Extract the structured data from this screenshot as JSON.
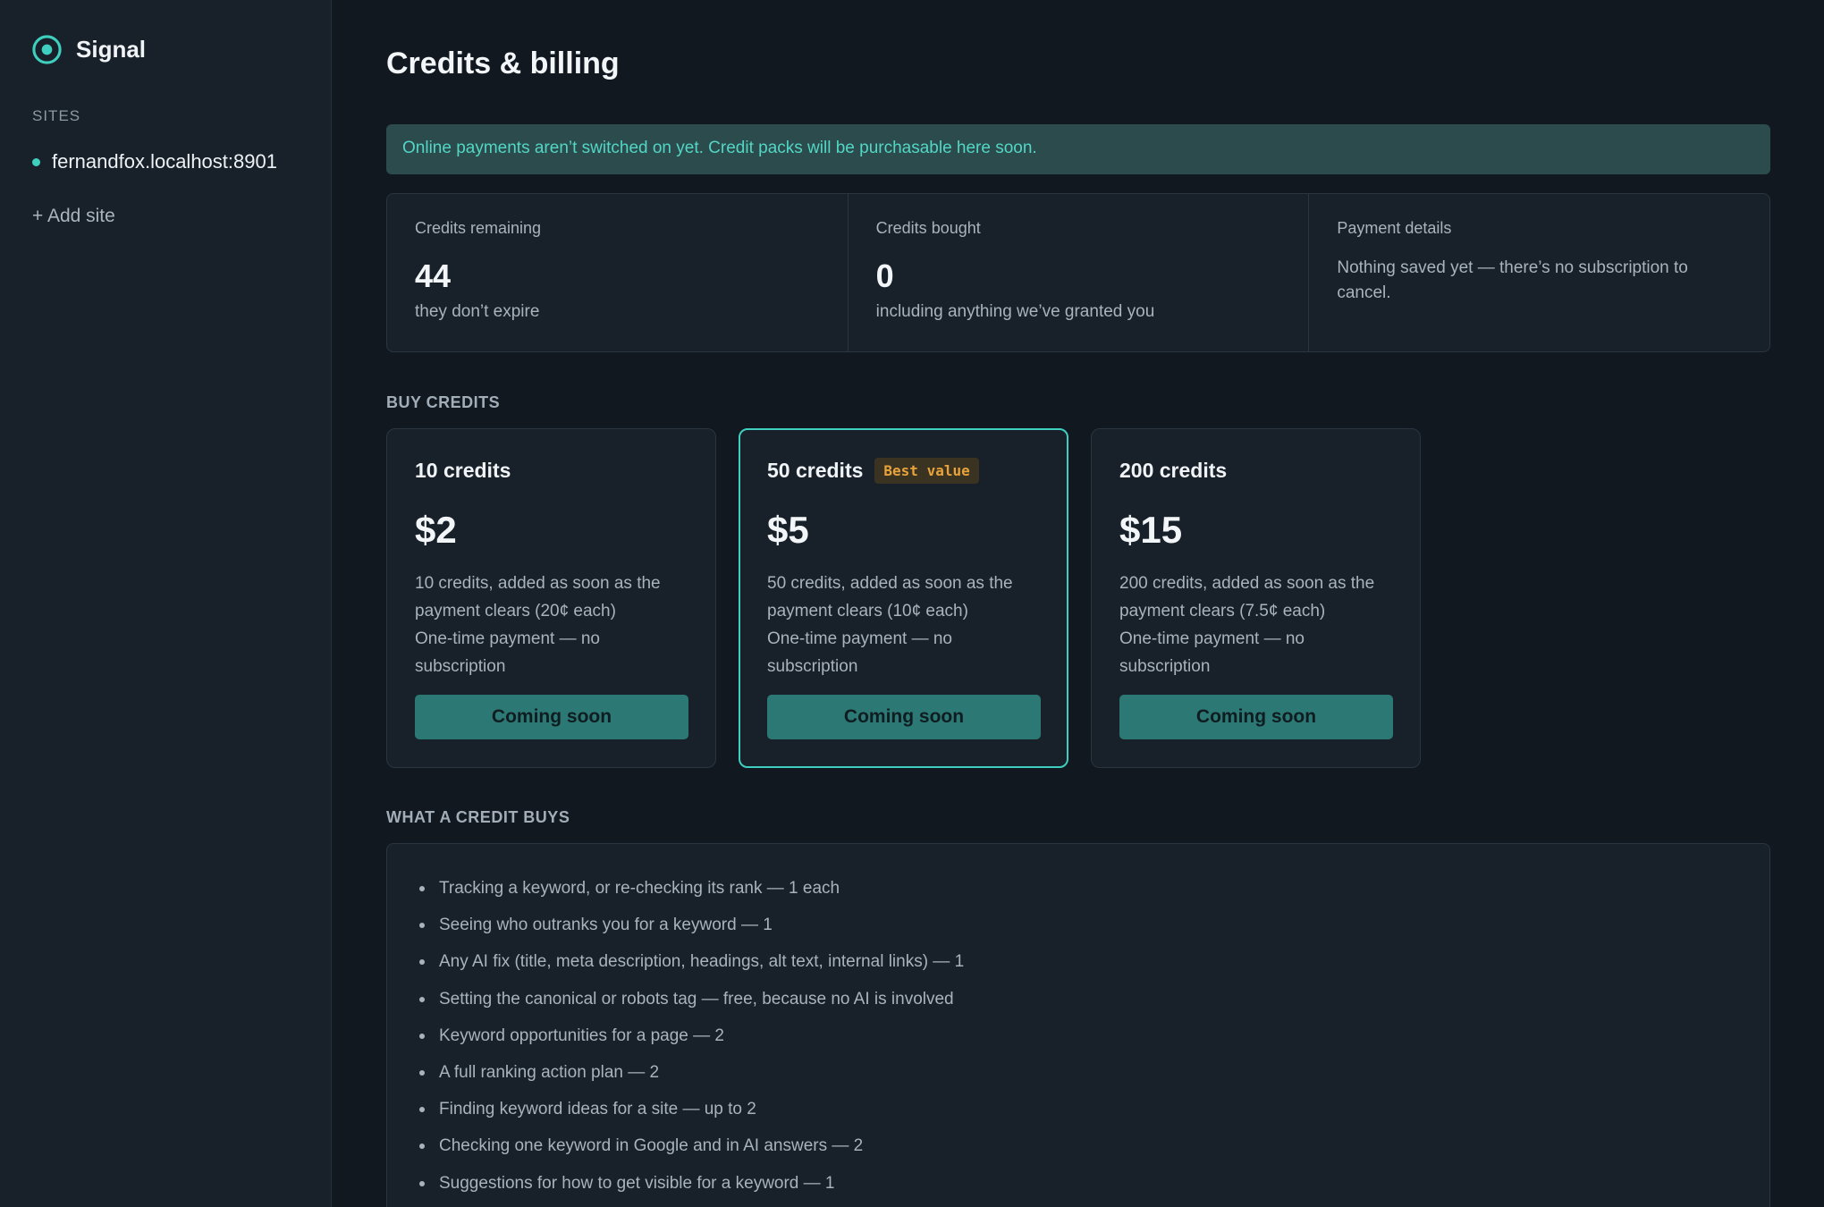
{
  "app": {
    "name": "Signal"
  },
  "sidebar": {
    "heading": "SITES",
    "sites": [
      {
        "label": "fernandfox.localhost:8901"
      }
    ],
    "add_site": "+ Add site"
  },
  "page": {
    "title": "Credits & billing",
    "notice": "Online payments aren’t switched on yet. Credit packs will be purchasable here soon."
  },
  "stats": {
    "remaining": {
      "label": "Credits remaining",
      "value": "44",
      "sub": "they don’t expire"
    },
    "bought": {
      "label": "Credits bought",
      "value": "0",
      "sub": "including anything we’ve granted you"
    },
    "payment": {
      "label": "Payment details",
      "desc": "Nothing saved yet — there’s no subscription to cancel."
    }
  },
  "buy": {
    "heading": "BUY CREDITS",
    "packs": [
      {
        "name": "10 credits",
        "badge": "",
        "price": "$2",
        "line1": "10 credits, added as soon as the payment clears (20¢ each)",
        "line2": "One-time payment — no subscription",
        "button": "Coming soon"
      },
      {
        "name": "50 credits",
        "badge": "Best value",
        "price": "$5",
        "line1": "50 credits, added as soon as the payment clears (10¢ each)",
        "line2": "One-time payment — no subscription",
        "button": "Coming soon"
      },
      {
        "name": "200 credits",
        "badge": "",
        "price": "$15",
        "line1": "200 credits, added as soon as the payment clears (7.5¢ each)",
        "line2": "One-time payment — no subscription",
        "button": "Coming soon"
      }
    ]
  },
  "uses": {
    "heading": "WHAT A CREDIT BUYS",
    "items": [
      "Tracking a keyword, or re-checking its rank — 1 each",
      "Seeing who outranks you for a keyword — 1",
      "Any AI fix (title, meta description, headings, alt text, internal links) — 1",
      "Setting the canonical or robots tag — free, because no AI is involved",
      "Keyword opportunities for a page — 2",
      "A full ranking action plan — 2",
      "Finding keyword ideas for a site — up to 2",
      "Checking one keyword in Google and in AI answers — 2",
      "Suggestions for how to get visible for a keyword — 1"
    ]
  },
  "colors": {
    "accent": "#3fcfbf",
    "background": "#111820",
    "panel": "#18202a",
    "button": "#2c7874",
    "badge": "#e8a33a"
  }
}
